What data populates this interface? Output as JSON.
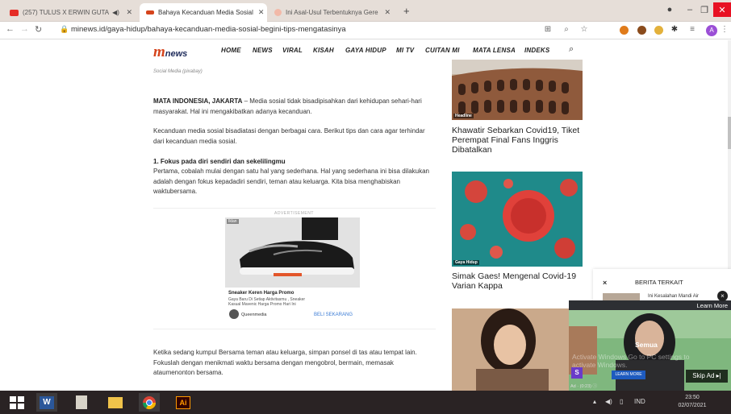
{
  "browser": {
    "tabs": [
      {
        "title": "(257) TULUS X ERWIN GUTA",
        "favicon_color": "#e52d27",
        "active": false
      },
      {
        "title": "Bahaya Kecanduan Media Sosial",
        "favicon_color": "#d5441c",
        "active": true
      },
      {
        "title": "Ini Asal-Usul Terbentuknya Gere",
        "favicon_color": "#f2b9a8",
        "active": false
      }
    ],
    "new_tab": "+",
    "url": "minews.id/gaya-hidup/bahaya-kecanduan-media-sosial-begini-tips-mengatasinya",
    "profile_initial": "A"
  },
  "site": {
    "logo_m": "m",
    "logo_news": "news",
    "nav": [
      "HOME",
      "NEWS",
      "VIRAL",
      "KISAH",
      "GAYA HIDUP",
      "MI TV",
      "CUITAN MI",
      "MATA LENSA",
      "INDEKS"
    ]
  },
  "article": {
    "caption": "Social Media (pixabay)",
    "lead_place": "MATA INDONESIA, JAKARTA",
    "lead_text": " – Media sosial tidak bisadipisahkan dari kehidupan sehari-hari masyarakat. Hal ini mengakibatkan adanya kecanduan.",
    "p2": "Kecanduan media sosial bisadiatasi dengan berbagai cara. Berikut tips dan cara agar terhindar dari kecanduan media sosial.",
    "h1": "1. Fokus pada diri sendiri dan sekelilingmu",
    "p3": "Pertama, cobalah mulai dengan satu hal yang sederhana. Hal yang sederhana ini bisa dilakukan adalah dengan fokus kepadadiri sendiri, teman atau keluarga. Kita bisa menghabiskan waktubersama.",
    "advertisement_label": "ADVERTISEMENT",
    "p4": "Ketika sedang kumpul Bersama teman atau keluarga, simpan ponsel di tas atau tempat lain. Fokuslah dengan menikmati waktu bersama dengan mengobrol, bermain, memasak ataumenonton bersama."
  },
  "ad": {
    "iklan": "Iklan",
    "title": "Sneaker Keren Harga Promo",
    "desc": "Gaya Baru Di Setiap Aktivitasmu , Sneaker Kasual Mavenic Harga Promo Hari Ini",
    "brand": "Queenmedia",
    "cta": "BELI SEKARANG"
  },
  "sidebar": {
    "items": [
      {
        "tag": "Headline",
        "title": "Khawatir Sebarkan Covid19, Tiket Perempat Final Fans Inggris Dibatalkan"
      },
      {
        "tag": "Gaya Hidup",
        "title": "Simak Gaes! Mengenal Covid-19 Varian Kappa"
      }
    ]
  },
  "related": {
    "close": "×",
    "heading": "BERITA TERKAIT",
    "item": "Ini Kesalahan Mandi Air"
  },
  "video_ad": {
    "learn_more": "Learn More",
    "close": "×",
    "semua": "Semua",
    "activate": "Activate Windows Go to PC settings to activate Windows.",
    "learn_button": "LEARN MORE",
    "skip": "Skip Ad ▸|",
    "ad_time": "Ad · (0:23)  ⓘ"
  },
  "taskbar": {
    "lang": "IND",
    "time": "23:50",
    "date": "02/07/2021",
    "ai_label": "Ai",
    "word_label": "W"
  }
}
